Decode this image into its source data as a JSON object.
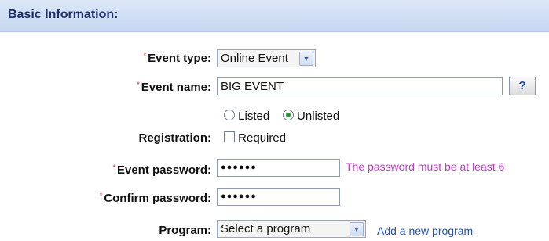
{
  "section": {
    "title": "Basic Information:"
  },
  "required_mark": "*",
  "event_type": {
    "label": "Event type:",
    "value": "Online Event",
    "dropdown_icon": "chevron-down-icon"
  },
  "event_name": {
    "label": "Event name:",
    "value": "BIG EVENT",
    "help_label": "?"
  },
  "registration": {
    "label": "Registration:",
    "radio_options": [
      {
        "label": "Listed",
        "checked": false
      },
      {
        "label": "Unlisted",
        "checked": true
      }
    ],
    "checkbox": {
      "label": "Required",
      "checked": false
    }
  },
  "event_password": {
    "label": "Event password:",
    "value": "●●●●●●",
    "note": "The password must be at least 6"
  },
  "confirm_password": {
    "label": "Confirm password:",
    "value": "●●●●●●"
  },
  "program": {
    "label": "Program:",
    "value": "Select a program",
    "add_link": "Add a new program",
    "dropdown_icon": "chevron-down-icon"
  },
  "colors": {
    "header_bg": "#c6d7f1",
    "header_text": "#1b2e6e",
    "note": "#c23ccc",
    "link": "#2653b6",
    "required": "#c22222"
  }
}
